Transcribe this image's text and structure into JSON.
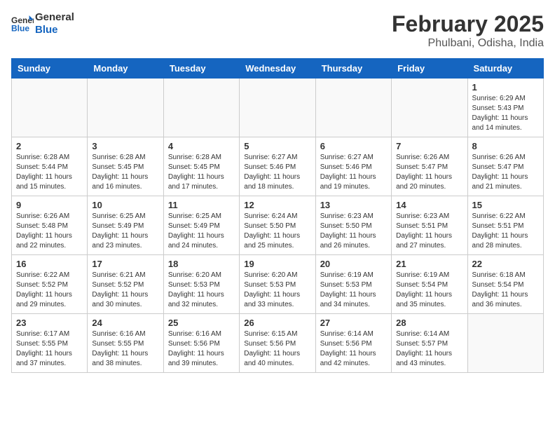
{
  "logo": {
    "line1": "General",
    "line2": "Blue"
  },
  "title": "February 2025",
  "subtitle": "Phulbani, Odisha, India",
  "weekdays": [
    "Sunday",
    "Monday",
    "Tuesday",
    "Wednesday",
    "Thursday",
    "Friday",
    "Saturday"
  ],
  "weeks": [
    [
      {
        "day": "",
        "info": ""
      },
      {
        "day": "",
        "info": ""
      },
      {
        "day": "",
        "info": ""
      },
      {
        "day": "",
        "info": ""
      },
      {
        "day": "",
        "info": ""
      },
      {
        "day": "",
        "info": ""
      },
      {
        "day": "1",
        "info": "Sunrise: 6:29 AM\nSunset: 5:43 PM\nDaylight: 11 hours\nand 14 minutes."
      }
    ],
    [
      {
        "day": "2",
        "info": "Sunrise: 6:28 AM\nSunset: 5:44 PM\nDaylight: 11 hours\nand 15 minutes."
      },
      {
        "day": "3",
        "info": "Sunrise: 6:28 AM\nSunset: 5:45 PM\nDaylight: 11 hours\nand 16 minutes."
      },
      {
        "day": "4",
        "info": "Sunrise: 6:28 AM\nSunset: 5:45 PM\nDaylight: 11 hours\nand 17 minutes."
      },
      {
        "day": "5",
        "info": "Sunrise: 6:27 AM\nSunset: 5:46 PM\nDaylight: 11 hours\nand 18 minutes."
      },
      {
        "day": "6",
        "info": "Sunrise: 6:27 AM\nSunset: 5:46 PM\nDaylight: 11 hours\nand 19 minutes."
      },
      {
        "day": "7",
        "info": "Sunrise: 6:26 AM\nSunset: 5:47 PM\nDaylight: 11 hours\nand 20 minutes."
      },
      {
        "day": "8",
        "info": "Sunrise: 6:26 AM\nSunset: 5:47 PM\nDaylight: 11 hours\nand 21 minutes."
      }
    ],
    [
      {
        "day": "9",
        "info": "Sunrise: 6:26 AM\nSunset: 5:48 PM\nDaylight: 11 hours\nand 22 minutes."
      },
      {
        "day": "10",
        "info": "Sunrise: 6:25 AM\nSunset: 5:49 PM\nDaylight: 11 hours\nand 23 minutes."
      },
      {
        "day": "11",
        "info": "Sunrise: 6:25 AM\nSunset: 5:49 PM\nDaylight: 11 hours\nand 24 minutes."
      },
      {
        "day": "12",
        "info": "Sunrise: 6:24 AM\nSunset: 5:50 PM\nDaylight: 11 hours\nand 25 minutes."
      },
      {
        "day": "13",
        "info": "Sunrise: 6:23 AM\nSunset: 5:50 PM\nDaylight: 11 hours\nand 26 minutes."
      },
      {
        "day": "14",
        "info": "Sunrise: 6:23 AM\nSunset: 5:51 PM\nDaylight: 11 hours\nand 27 minutes."
      },
      {
        "day": "15",
        "info": "Sunrise: 6:22 AM\nSunset: 5:51 PM\nDaylight: 11 hours\nand 28 minutes."
      }
    ],
    [
      {
        "day": "16",
        "info": "Sunrise: 6:22 AM\nSunset: 5:52 PM\nDaylight: 11 hours\nand 29 minutes."
      },
      {
        "day": "17",
        "info": "Sunrise: 6:21 AM\nSunset: 5:52 PM\nDaylight: 11 hours\nand 30 minutes."
      },
      {
        "day": "18",
        "info": "Sunrise: 6:20 AM\nSunset: 5:53 PM\nDaylight: 11 hours\nand 32 minutes."
      },
      {
        "day": "19",
        "info": "Sunrise: 6:20 AM\nSunset: 5:53 PM\nDaylight: 11 hours\nand 33 minutes."
      },
      {
        "day": "20",
        "info": "Sunrise: 6:19 AM\nSunset: 5:53 PM\nDaylight: 11 hours\nand 34 minutes."
      },
      {
        "day": "21",
        "info": "Sunrise: 6:19 AM\nSunset: 5:54 PM\nDaylight: 11 hours\nand 35 minutes."
      },
      {
        "day": "22",
        "info": "Sunrise: 6:18 AM\nSunset: 5:54 PM\nDaylight: 11 hours\nand 36 minutes."
      }
    ],
    [
      {
        "day": "23",
        "info": "Sunrise: 6:17 AM\nSunset: 5:55 PM\nDaylight: 11 hours\nand 37 minutes."
      },
      {
        "day": "24",
        "info": "Sunrise: 6:16 AM\nSunset: 5:55 PM\nDaylight: 11 hours\nand 38 minutes."
      },
      {
        "day": "25",
        "info": "Sunrise: 6:16 AM\nSunset: 5:56 PM\nDaylight: 11 hours\nand 39 minutes."
      },
      {
        "day": "26",
        "info": "Sunrise: 6:15 AM\nSunset: 5:56 PM\nDaylight: 11 hours\nand 40 minutes."
      },
      {
        "day": "27",
        "info": "Sunrise: 6:14 AM\nSunset: 5:56 PM\nDaylight: 11 hours\nand 42 minutes."
      },
      {
        "day": "28",
        "info": "Sunrise: 6:14 AM\nSunset: 5:57 PM\nDaylight: 11 hours\nand 43 minutes."
      },
      {
        "day": "",
        "info": ""
      }
    ]
  ]
}
